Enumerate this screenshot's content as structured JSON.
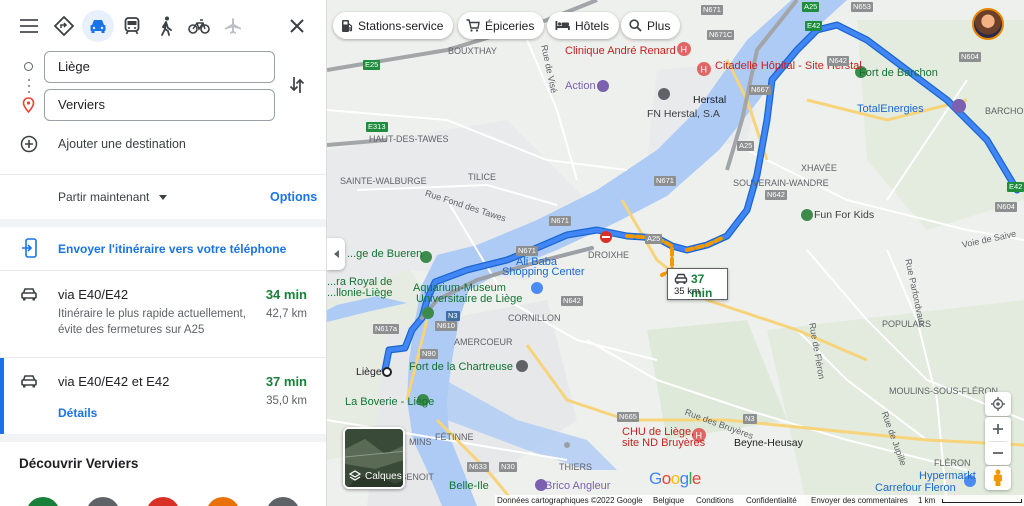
{
  "panel": {
    "modes": [
      {
        "name": "menu-icon",
        "label": ""
      },
      {
        "name": "best-route-icon",
        "label": ""
      },
      {
        "name": "car-icon",
        "label": "",
        "active": true
      },
      {
        "name": "transit-icon",
        "label": ""
      },
      {
        "name": "walk-icon",
        "label": ""
      },
      {
        "name": "bike-icon",
        "label": ""
      },
      {
        "name": "flight-icon",
        "label": ""
      },
      {
        "name": "close-icon",
        "label": ""
      }
    ],
    "origin": "Liège",
    "destination": "Verviers",
    "add_destination": "Ajouter une destination",
    "depart_label": "Partir maintenant",
    "options_label": "Options",
    "send_to_phone": "Envoyer l'itinéraire vers votre téléphone",
    "routes": [
      {
        "via": "via E40/E42",
        "time": "34 min",
        "distance": "42,7 km",
        "description": "Itinéraire le plus rapide actuellement, évite des fermetures sur A25"
      },
      {
        "via": "via E40/E42 et E42",
        "time": "37 min",
        "distance": "35,0 km",
        "details_label": "Détails",
        "selected": true
      }
    ],
    "discover_title": "Découvrir Verviers"
  },
  "map": {
    "chips": [
      {
        "label": "Stations-service",
        "icon": "gas-station-icon"
      },
      {
        "label": "Épiceries",
        "icon": "cart-icon"
      },
      {
        "label": "Hôtels",
        "icon": "bed-icon"
      },
      {
        "label": "Plus",
        "icon": "search-icon"
      }
    ],
    "route_bubble": {
      "time": "37 min",
      "distance": "35 km"
    },
    "layers_label": "Calques",
    "footer": {
      "data": "Données cartographiques ©2022 Google",
      "country": "Belgique",
      "terms": "Conditions",
      "privacy": "Confidentialité",
      "feedback": "Envoyer des commentaires",
      "scale": "1 km"
    },
    "logo": "Google",
    "places": {
      "herstal": "Herstal",
      "liege": "Liège",
      "beyne": "Beyne-Heusay",
      "fleron": "FLÉRON",
      "barchon": "BARCHON",
      "xhavee": "XHAVÉE",
      "souverain": "SOUVERAIN-WANDRE",
      "populars": "POPULARS",
      "moulins": "MOULINS-SOUS-FLÉRON",
      "haut_tawes": "HAUT-DES-TAWES",
      "tilice": "TILICE",
      "sainte_walburge": "SAINTE-WALBURGE",
      "bouxthay": "BOUXTHAY",
      "droixhe": "DROIXHE",
      "cornillon": "CORNILLON",
      "amercoeur": "AMERCOEUR",
      "fetinne": "FÉTINNE",
      "thiers": "THIERS",
      "val_benoit": "VAL-BENOIT",
      "mins": "MINS"
    },
    "pois": {
      "clinique": "Clinique André Renard",
      "citadelle": "Citadelle Hôpital - Site Herstal",
      "action": "Action",
      "fn_herstal": "FN Herstal, S.A",
      "fort_barchon": "Fort de Barchon",
      "total": "TotalEnergies",
      "fun_for_kids": "Fun For Kids",
      "jardin_bueren": "...ge de Bueren",
      "ali_baba": "Ali Baba",
      "shopping": "Shopping Center",
      "aquarium": "Aquarium-Museum",
      "universitaire": "Universitaire de Liège",
      "opera": "...ra Royal de",
      "wallonie": "...llonie-Liège",
      "fort_chartreuse": "Fort de la Chartreuse",
      "boverie": "La Boverie - Liège",
      "chu": "CHU de Liège,",
      "chu_site": "site ND Bruyères",
      "brico": "Brico Angleur",
      "belle_ile": "Belle-Ile",
      "hypermarket": "Hypermarkt",
      "carrefour": "Carrefour Fleron"
    },
    "roads": {
      "rue_visé": "Rue de Visé",
      "rue_fond_tawes": "Rue Fond des Tawes",
      "rue_fleron": "Rue de Fléron",
      "rue_jupille": "Rue de Jupille",
      "rue_parfondvaux": "Rue Parfondvaux",
      "voie_saive": "Voie de Saive",
      "rue_bruyeres": "Rue des Bruyères"
    },
    "shields": [
      "A25",
      "E42",
      "N671",
      "N671C",
      "N653",
      "N604",
      "E25",
      "N667",
      "N642",
      "E313",
      "N671",
      "A25",
      "N642",
      "N617a",
      "N3",
      "N610",
      "N90",
      "N665",
      "N3",
      "N633",
      "N30",
      "N604",
      "E42"
    ]
  }
}
